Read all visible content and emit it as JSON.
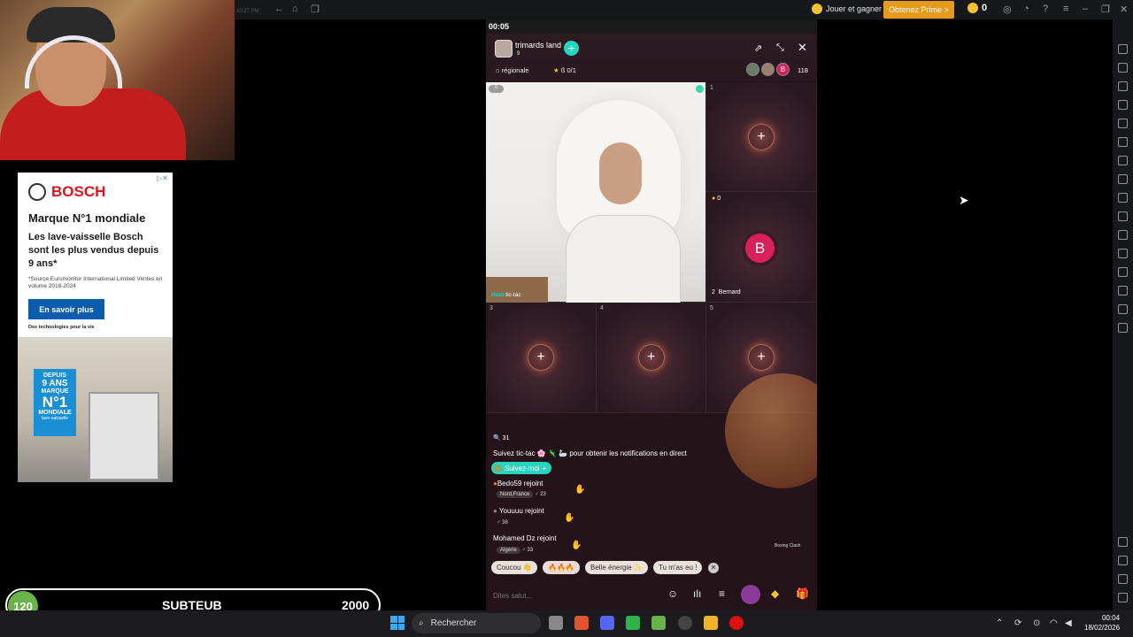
{
  "emulator_bar": {
    "clock": "10:27 PM",
    "jouer": "Jouer et gagner",
    "prime": "Obtenez Prime >",
    "coins": "0"
  },
  "ad": {
    "brand": "BOSCH",
    "headline": "Marque N°1 mondiale",
    "body": "Les lave-vaisselle Bosch sont les plus vendus depuis 9 ans*",
    "source": "*Source Euromonitor International Limited Ventes en volume 2018-2024",
    "cta": "En savoir plus",
    "tagline": "Des technologies pour la vie",
    "badge_line1": "DEPUIS",
    "badge_line2": "9 ANS",
    "badge_line3": "MARQUE",
    "badge_line4": "N°1",
    "badge_line5": "MONDIALE",
    "badge_line6": "lave-vaisselle"
  },
  "subgoal": {
    "count": "120",
    "label": "SUBTEUB",
    "goal": "2000"
  },
  "phone": {
    "status_time": "00:05",
    "room_name": "trimards land",
    "room_sub": "9",
    "region": "régionale",
    "stars": "0/1",
    "viewer_count": "118",
    "main_badge": "0",
    "host_label": "Host",
    "host_name": "tic-tac",
    "seats": [
      {
        "num": "1"
      },
      {
        "num": "3"
      },
      {
        "num": "4"
      },
      {
        "num": "5"
      }
    ],
    "bernard": {
      "gift": "0",
      "num": "2",
      "name": "Bernard",
      "initial": "B"
    },
    "chat": {
      "count": "31",
      "follow_prompt": "Suivez tic-tac 🌸 🦎 🦢 pour obtenir les notifications en direct",
      "follow_button": "Suivez-moi",
      "messages": [
        {
          "user": "Bedo59 rejoint",
          "loc": "Nord,France",
          "level": "23"
        },
        {
          "user": "Youuuu rejoint",
          "level": "38"
        },
        {
          "user": "Mohamed Dz rejoint",
          "loc": "Algérie",
          "level": "33"
        }
      ]
    },
    "quick_replies": [
      "Coucou 👋",
      "🔥🔥🔥",
      "Belle énergie ✨",
      "Tu m'as eu !"
    ],
    "input_placeholder": "Dites salut...",
    "boxing": "Boxing Clash"
  },
  "taskbar": {
    "search": "Rechercher",
    "time": "00:04",
    "date": "18/02/2026"
  }
}
